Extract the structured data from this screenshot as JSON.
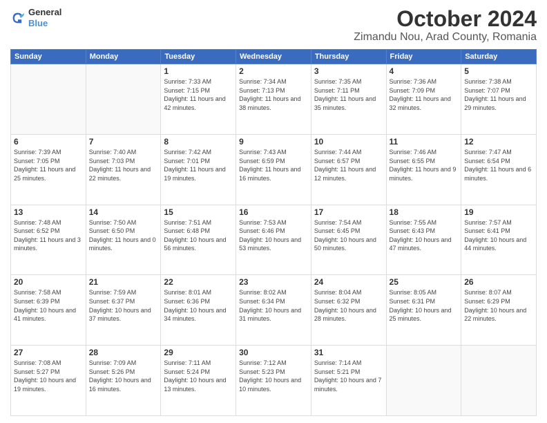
{
  "logo": {
    "general": "General",
    "blue": "Blue"
  },
  "title": "October 2024",
  "subtitle": "Zimandu Nou, Arad County, Romania",
  "days": [
    "Sunday",
    "Monday",
    "Tuesday",
    "Wednesday",
    "Thursday",
    "Friday",
    "Saturday"
  ],
  "weeks": [
    [
      {
        "day": "",
        "info": ""
      },
      {
        "day": "",
        "info": ""
      },
      {
        "day": "1",
        "info": "Sunrise: 7:33 AM\nSunset: 7:15 PM\nDaylight: 11 hours and 42 minutes."
      },
      {
        "day": "2",
        "info": "Sunrise: 7:34 AM\nSunset: 7:13 PM\nDaylight: 11 hours and 38 minutes."
      },
      {
        "day": "3",
        "info": "Sunrise: 7:35 AM\nSunset: 7:11 PM\nDaylight: 11 hours and 35 minutes."
      },
      {
        "day": "4",
        "info": "Sunrise: 7:36 AM\nSunset: 7:09 PM\nDaylight: 11 hours and 32 minutes."
      },
      {
        "day": "5",
        "info": "Sunrise: 7:38 AM\nSunset: 7:07 PM\nDaylight: 11 hours and 29 minutes."
      }
    ],
    [
      {
        "day": "6",
        "info": "Sunrise: 7:39 AM\nSunset: 7:05 PM\nDaylight: 11 hours and 25 minutes."
      },
      {
        "day": "7",
        "info": "Sunrise: 7:40 AM\nSunset: 7:03 PM\nDaylight: 11 hours and 22 minutes."
      },
      {
        "day": "8",
        "info": "Sunrise: 7:42 AM\nSunset: 7:01 PM\nDaylight: 11 hours and 19 minutes."
      },
      {
        "day": "9",
        "info": "Sunrise: 7:43 AM\nSunset: 6:59 PM\nDaylight: 11 hours and 16 minutes."
      },
      {
        "day": "10",
        "info": "Sunrise: 7:44 AM\nSunset: 6:57 PM\nDaylight: 11 hours and 12 minutes."
      },
      {
        "day": "11",
        "info": "Sunrise: 7:46 AM\nSunset: 6:55 PM\nDaylight: 11 hours and 9 minutes."
      },
      {
        "day": "12",
        "info": "Sunrise: 7:47 AM\nSunset: 6:54 PM\nDaylight: 11 hours and 6 minutes."
      }
    ],
    [
      {
        "day": "13",
        "info": "Sunrise: 7:48 AM\nSunset: 6:52 PM\nDaylight: 11 hours and 3 minutes."
      },
      {
        "day": "14",
        "info": "Sunrise: 7:50 AM\nSunset: 6:50 PM\nDaylight: 11 hours and 0 minutes."
      },
      {
        "day": "15",
        "info": "Sunrise: 7:51 AM\nSunset: 6:48 PM\nDaylight: 10 hours and 56 minutes."
      },
      {
        "day": "16",
        "info": "Sunrise: 7:53 AM\nSunset: 6:46 PM\nDaylight: 10 hours and 53 minutes."
      },
      {
        "day": "17",
        "info": "Sunrise: 7:54 AM\nSunset: 6:45 PM\nDaylight: 10 hours and 50 minutes."
      },
      {
        "day": "18",
        "info": "Sunrise: 7:55 AM\nSunset: 6:43 PM\nDaylight: 10 hours and 47 minutes."
      },
      {
        "day": "19",
        "info": "Sunrise: 7:57 AM\nSunset: 6:41 PM\nDaylight: 10 hours and 44 minutes."
      }
    ],
    [
      {
        "day": "20",
        "info": "Sunrise: 7:58 AM\nSunset: 6:39 PM\nDaylight: 10 hours and 41 minutes."
      },
      {
        "day": "21",
        "info": "Sunrise: 7:59 AM\nSunset: 6:37 PM\nDaylight: 10 hours and 37 minutes."
      },
      {
        "day": "22",
        "info": "Sunrise: 8:01 AM\nSunset: 6:36 PM\nDaylight: 10 hours and 34 minutes."
      },
      {
        "day": "23",
        "info": "Sunrise: 8:02 AM\nSunset: 6:34 PM\nDaylight: 10 hours and 31 minutes."
      },
      {
        "day": "24",
        "info": "Sunrise: 8:04 AM\nSunset: 6:32 PM\nDaylight: 10 hours and 28 minutes."
      },
      {
        "day": "25",
        "info": "Sunrise: 8:05 AM\nSunset: 6:31 PM\nDaylight: 10 hours and 25 minutes."
      },
      {
        "day": "26",
        "info": "Sunrise: 8:07 AM\nSunset: 6:29 PM\nDaylight: 10 hours and 22 minutes."
      }
    ],
    [
      {
        "day": "27",
        "info": "Sunrise: 7:08 AM\nSunset: 5:27 PM\nDaylight: 10 hours and 19 minutes."
      },
      {
        "day": "28",
        "info": "Sunrise: 7:09 AM\nSunset: 5:26 PM\nDaylight: 10 hours and 16 minutes."
      },
      {
        "day": "29",
        "info": "Sunrise: 7:11 AM\nSunset: 5:24 PM\nDaylight: 10 hours and 13 minutes."
      },
      {
        "day": "30",
        "info": "Sunrise: 7:12 AM\nSunset: 5:23 PM\nDaylight: 10 hours and 10 minutes."
      },
      {
        "day": "31",
        "info": "Sunrise: 7:14 AM\nSunset: 5:21 PM\nDaylight: 10 hours and 7 minutes."
      },
      {
        "day": "",
        "info": ""
      },
      {
        "day": "",
        "info": ""
      }
    ]
  ]
}
